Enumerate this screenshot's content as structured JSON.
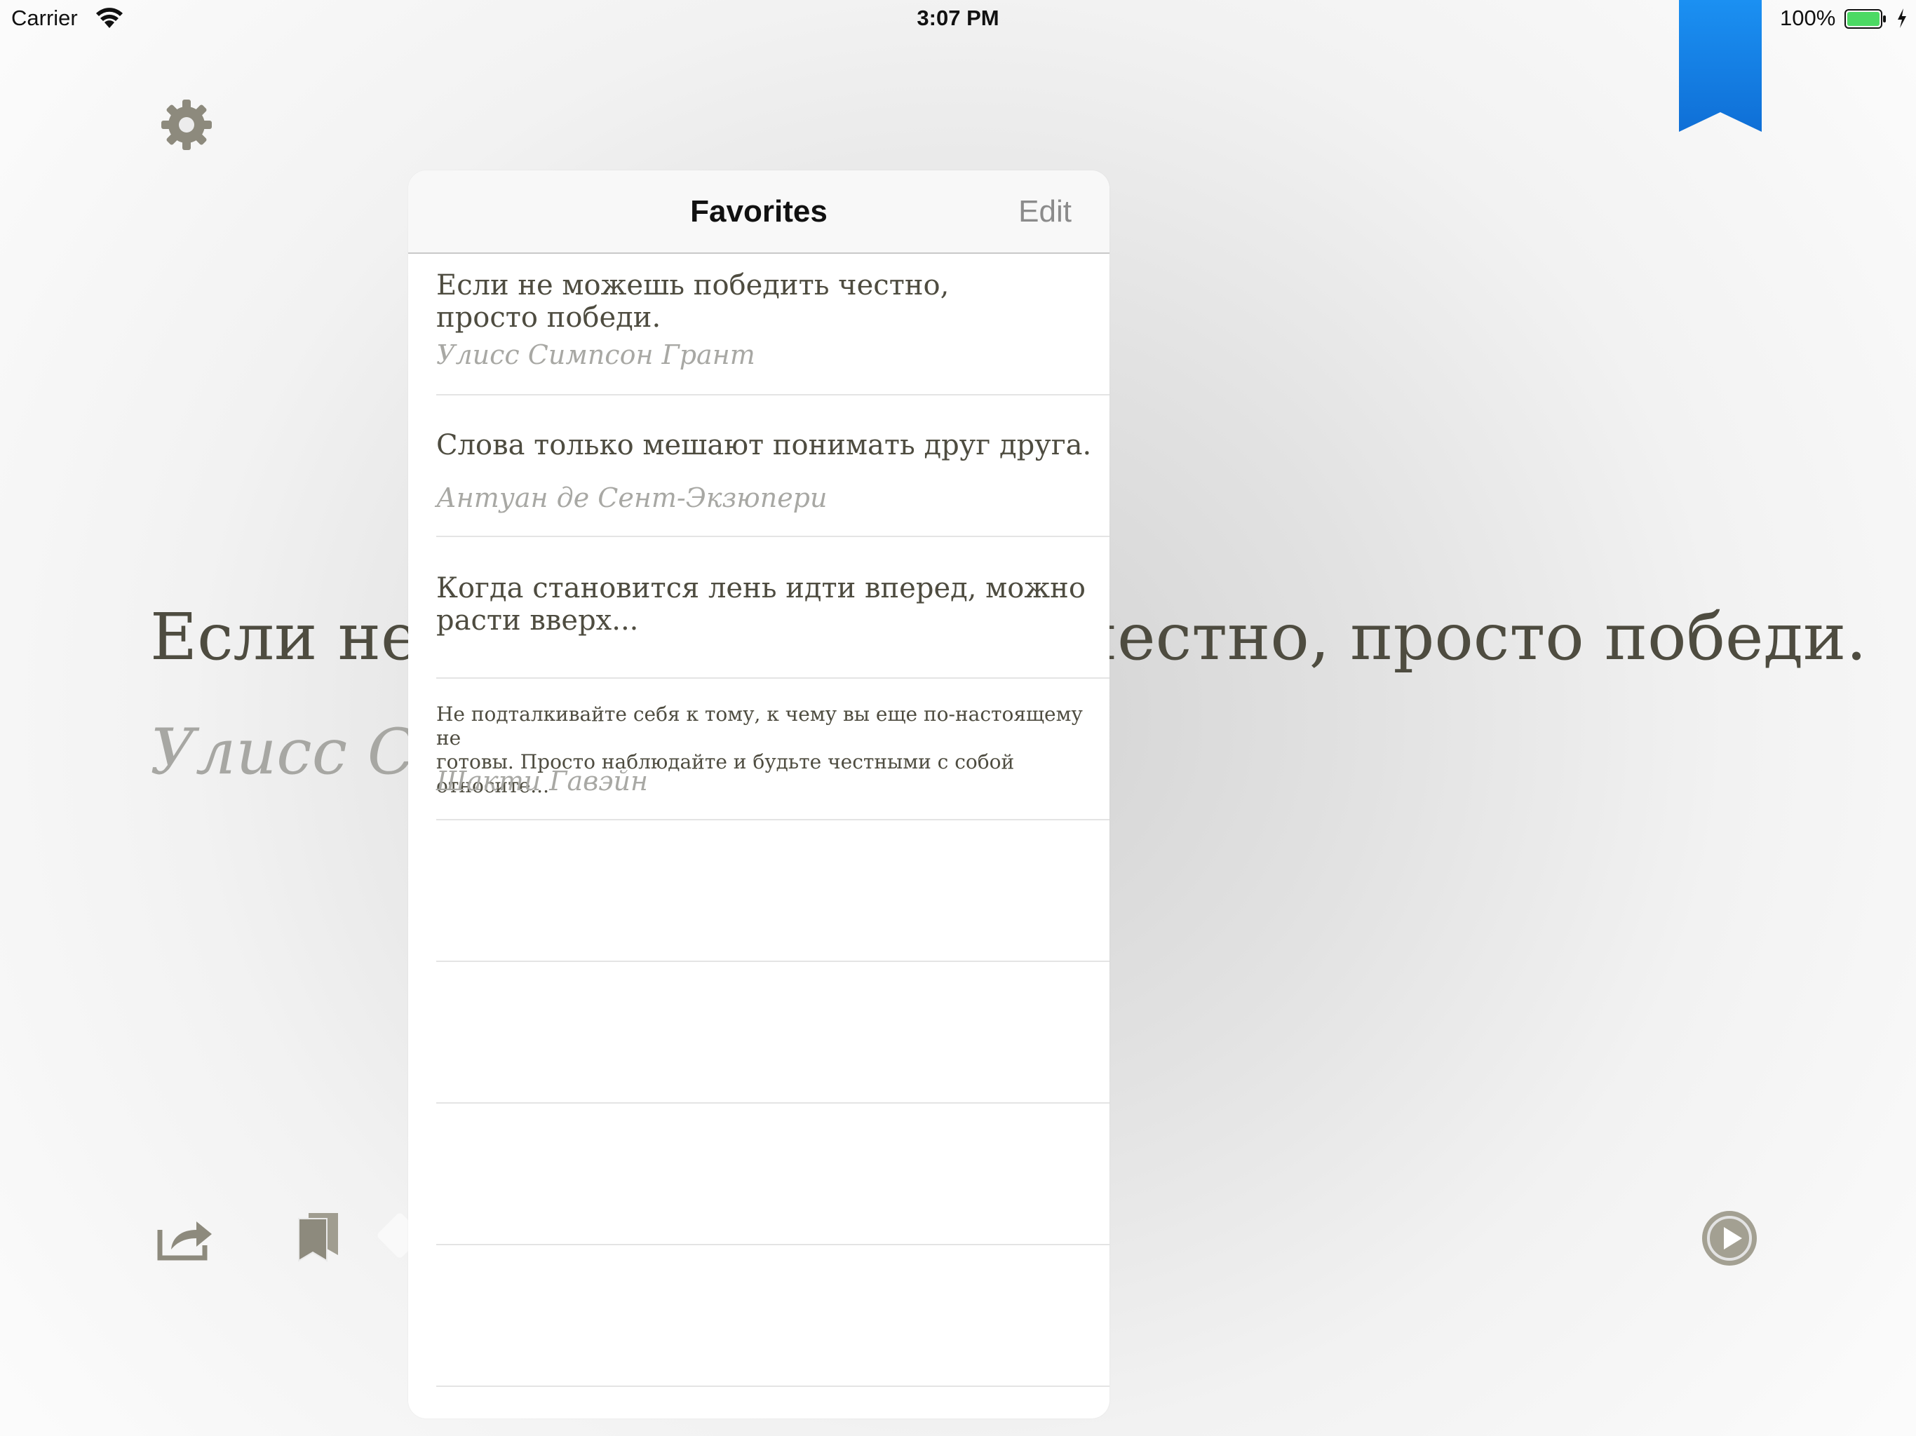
{
  "status_bar": {
    "carrier": "Carrier",
    "time": "3:07 PM",
    "battery": "100%",
    "battery_color": "#4cd964"
  },
  "reader": {
    "quote": "Если не можешь победить честно, просто победи.",
    "author": "Улисс Симпсон Грант",
    "text_color": "#4e4c40",
    "author_color": "#a7a7a3",
    "ribbon_color": "#1a7fe6",
    "icons": [
      "gear-icon",
      "bookmark-ribbon-icon",
      "share-icon",
      "bookmarks-icon",
      "play-icon"
    ]
  },
  "favorites": {
    "title": "Favorites",
    "edit_label": "Edit",
    "items": [
      {
        "quote_line1": "Если не можешь победить честно,",
        "quote_line2": "просто победи.",
        "author": "Улисс Симпсон Грант"
      },
      {
        "quote_line1": "Слова только мешают понимать друг друга.",
        "quote_line2": "",
        "author": "Антуан де Сент-Экзюпери"
      },
      {
        "quote_line1": "Когда становится лень идти вперед, можно",
        "quote_line2": "расти вверх...",
        "author": ""
      },
      {
        "quote_line1": "Не подталкивайте себя к тому, к чему вы еще по-настоящему не",
        "quote_line2": "готовы. Просто наблюдайте и будьте честными с собой относите...",
        "author": "Шакти Гавэйн"
      }
    ]
  }
}
